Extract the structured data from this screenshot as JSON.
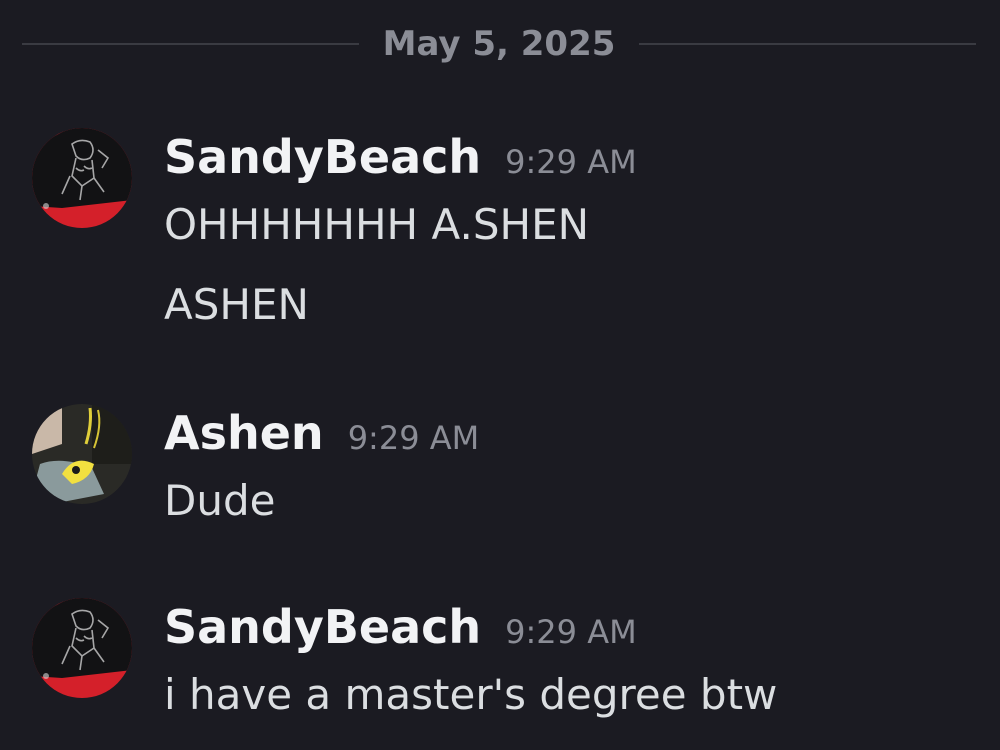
{
  "date_divider": "May 5, 2025",
  "messages": [
    {
      "username": "SandyBeach",
      "timestamp": "9:29 AM",
      "lines": [
        "OHHHHHHH A.SHEN",
        "ASHEN"
      ],
      "avatar": "sandybeach-avatar"
    },
    {
      "username": "Ashen",
      "timestamp": "9:29 AM",
      "lines": [
        "Dude"
      ],
      "avatar": "ashen-avatar"
    },
    {
      "username": "SandyBeach",
      "timestamp": "9:29 AM",
      "lines": [
        "i have a master's degree btw"
      ],
      "avatar": "sandybeach-avatar"
    }
  ],
  "colors": {
    "background": "#1b1b22",
    "username": "#f2f3f5",
    "message_text": "#dbdee1",
    "muted": "#8b8d96",
    "divider": "#3a3b42",
    "avatar_red": "#d4202a"
  }
}
